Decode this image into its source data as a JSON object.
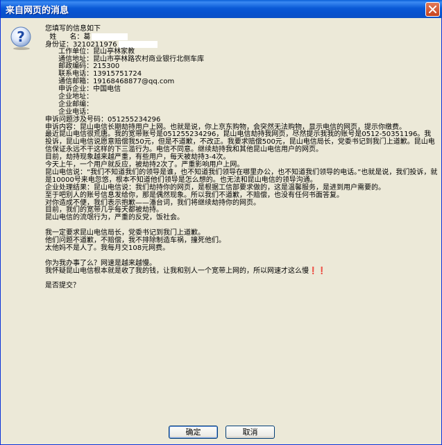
{
  "window": {
    "title": "来自网页的消息",
    "icon": "question-icon"
  },
  "message": {
    "lines": [
      "您填写的信息如下",
      "  姓      名：葛",
      "身份证：3210211976",
      "      工作单位：昆山亭林家教",
      "      通信地址：昆山市亭林路农村商业银行北侧车库",
      "      邮政编码：215300",
      "      联系电话：13915751724",
      "      通信邮箱：19168468877@qq.com",
      "      申诉企业：中国电信",
      "      企业地址：",
      "      企业邮编：",
      "      企业电话：",
      "申诉问题涉及号码：051255234296",
      "    申诉内容：昆山电信长期劫持用户上网。也就是说，你上京东购物，会突然无法购物，显示电信的网页，提示你缴费。",
      "最近昆山电信很荒唐。我的宽带账号是051255234296，昆山电信劫持我网页，尽然提示我我的账号是0512-50351196。我投诉，昆山电信说愿意赔偿我50元，但是不道歉，不改正。我要求赔偿500元，昆山电信局长，党委书记到我门上道歉。昆山电信保证永远不干这样的下三滥行为。电信不同意。继续劫持我和其他昆山电信用户的网页。",
      "目前，劫持现象越来越严重，有些用户，每天被劫持3-4次。",
      "今天上午，一个用户就反应，被劫持2次了。严重影响用户上网。",
      "昆山电信说：“我们不知道我们的领导是谁，也不知道我们领导在哪里办公，也不知道我们领导的电话。”也就是说，我们投诉，就是10000号来电忽悠，根本不知道他们领导是怎么想的。也无法和昆山电信的领导沟通。",
      "企业处理结果：昆山电信说：我们劫持你的网页，是根据工信部要求做的，这是温馨服务，是进到用户需要的。",
      "至于吧别人的账号信息发给你，那是偶然现象。所以我们不道歉，不赔偿，也没有任何书面答复。",
      "对你造成不便，我们表示抱歉——潘台词，我们将继续劫持你的网页。",
      "目前，我们的宽带几乎每天都被劫持。",
      "昆山电信的流氓行为，严重的反党，饭社会。",
      "",
      "我一定要求昆山电信局长，党委书记到我门上道歉。",
      "他们问题不道歉，不赔偿，我不排除制造车祸，撞死他们。",
      "太他妈不是人了。我每月交108元网费。",
      "",
      "你为我办事了么？网速是越来越慢。",
      "我怀疑昆山电信根本就是收了我的钱，让我和别人一个宽带上网的，所以网速才这么慢❗❗",
      "",
      "是否提交？"
    ]
  },
  "buttons": {
    "ok_label": "确定",
    "cancel_label": "取消"
  }
}
